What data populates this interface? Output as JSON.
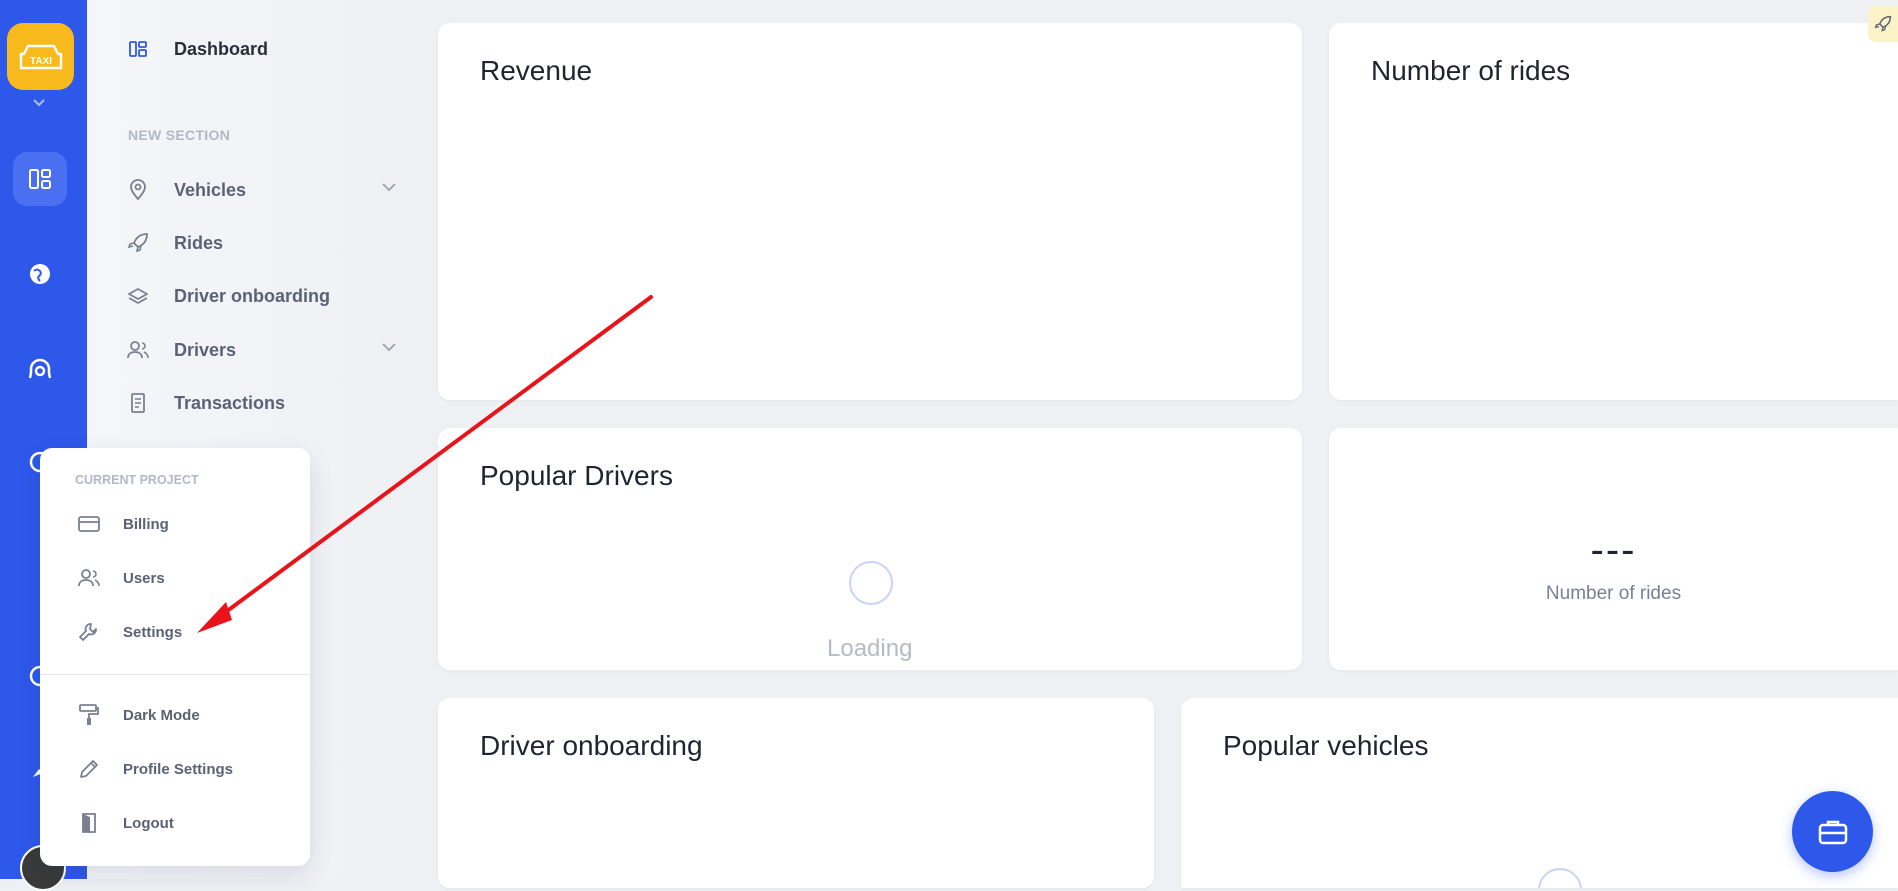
{
  "logo": {
    "text": "TAXI"
  },
  "nav": {
    "dashboard": "Dashboard",
    "section": "NEW SECTION",
    "items": [
      {
        "label": "Vehicles",
        "icon": "map-pin-icon",
        "has_children": true
      },
      {
        "label": "Rides",
        "icon": "rocket-icon",
        "has_children": false
      },
      {
        "label": "Driver onboarding",
        "icon": "layers-icon",
        "has_children": false
      },
      {
        "label": "Drivers",
        "icon": "users-icon",
        "has_children": true
      },
      {
        "label": "Transactions",
        "icon": "receipt-icon",
        "has_children": false
      }
    ]
  },
  "cards": {
    "revenue": {
      "title": "Revenue"
    },
    "rides": {
      "title": "Number of rides"
    },
    "popular_drivers": {
      "title": "Popular Drivers",
      "loading": "Loading"
    },
    "rides_stat": {
      "value": "---",
      "label": "Number of rides"
    },
    "driver_onboarding": {
      "title": "Driver onboarding"
    },
    "popular_vehicles": {
      "title": "Popular vehicles"
    }
  },
  "popup": {
    "section": "CURRENT PROJECT",
    "billing": "Billing",
    "users": "Users",
    "settings": "Settings",
    "dark_mode": "Dark Mode",
    "profile_settings": "Profile Settings",
    "logout": "Logout"
  },
  "colors": {
    "primary": "#2e58ea",
    "logo": "#f7b91c",
    "annotation_arrow": "#e8141a"
  }
}
